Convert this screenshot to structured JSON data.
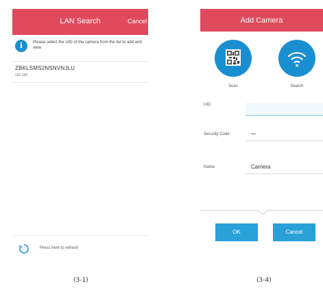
{
  "lan_search": {
    "title": "LAN Search",
    "cancel_label": "Cancel",
    "info_text": "Please select the UID of the camera from the list to add and view",
    "device": {
      "uid": "ZBKLSMS2NSNVNJLU",
      "ip": "192.168"
    },
    "refresh_label": "Press here to refresh"
  },
  "add_camera": {
    "title": "Add Camera",
    "scan_label": "Scan",
    "search_label": "Search",
    "uid_label": "UID",
    "uid_value": "",
    "security_code_label": "Security Code",
    "security_code_value": "••••",
    "name_label": "Name",
    "name_value": "Camera",
    "ok_label": "OK",
    "cancel_label": "Cancel"
  },
  "captions": {
    "left": "(3-1)",
    "right": "(3-4)"
  },
  "colors": {
    "header": "#e04a5c",
    "accent_blue": "#1a8fd0",
    "button_blue": "#2aa0d8"
  },
  "icons": {
    "info": "info-icon",
    "refresh": "refresh-icon",
    "qr": "qr-code-icon",
    "wifi": "wifi-icon"
  }
}
